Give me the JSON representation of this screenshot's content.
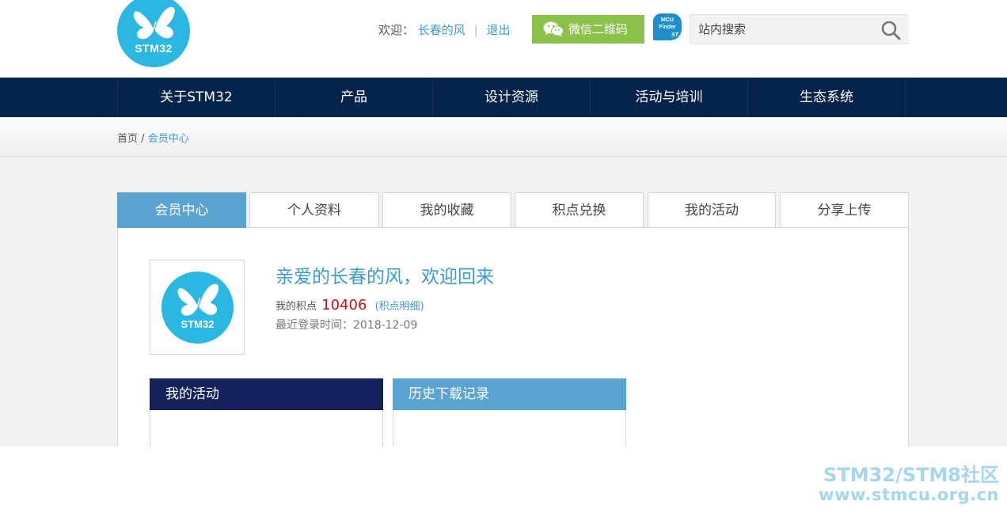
{
  "header": {
    "logo_text": "STM32",
    "welcome_label": "欢迎：",
    "username": "长春的风",
    "logout_label": "退出",
    "wechat_label": "微信二维码",
    "mcu_finder_line1": "MCU",
    "mcu_finder_line2": "Finder",
    "search_placeholder": "站内搜索"
  },
  "nav": {
    "items": [
      "关于STM32",
      "产品",
      "设计资源",
      "活动与培训",
      "生态系统"
    ]
  },
  "breadcrumb": {
    "home": "首页",
    "separator": "/",
    "current": "会员中心"
  },
  "tabs": [
    "会员中心",
    "个人资料",
    "我的收藏",
    "积点兑换",
    "我的活动",
    "分享上传"
  ],
  "profile": {
    "avatar_text": "STM32",
    "greeting": "亲爱的长春的风，欢迎回来",
    "points_label": "我的积点",
    "points_value": "10406",
    "points_detail_link": "(积点明细)",
    "last_login": "最近登录时间：2018-12-09"
  },
  "boxes": {
    "my_activities_title": "我的活动",
    "download_history_title": "历史下载记录"
  },
  "watermark": {
    "line1": "STM32/STM8社区",
    "line2": "www.stmcu.org.cn"
  },
  "colors": {
    "nav_bg": "#03234b",
    "accent_blue": "#5ba3d0",
    "link_blue": "#3a9cd0",
    "logo_cyan": "#2ab8e2",
    "wechat_green": "#8bc34a",
    "points_red": "#c0141a",
    "box_dark": "#14215a"
  }
}
